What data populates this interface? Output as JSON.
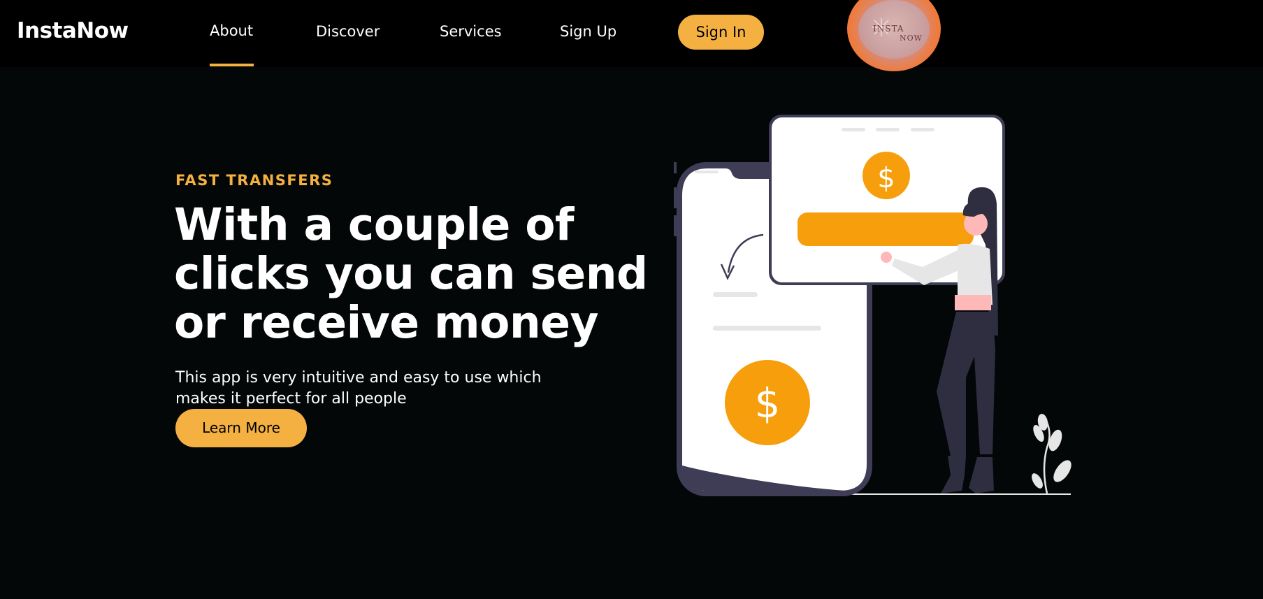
{
  "header": {
    "brand": "InstaNow",
    "nav": [
      {
        "label": "About",
        "active": true
      },
      {
        "label": "Discover"
      },
      {
        "label": "Services"
      },
      {
        "label": "Sign Up"
      }
    ],
    "signin_label": "Sign In",
    "logo_text_top": "INSTA",
    "logo_text_bottom": "NOW"
  },
  "hero": {
    "eyebrow": "FAST TRANSFERS",
    "headline_lines": [
      "With a couple of",
      "clicks you can send",
      "or receive money"
    ],
    "subtext_lines": [
      "This app is very intuitive and easy to use which",
      "makes it perfect for all people"
    ],
    "cta_label": "Learn More"
  },
  "illustration": {
    "currency_symbol": "$",
    "icons": [
      "phone-icon",
      "payment-card-icon",
      "dollar-coin-icon",
      "woman-figure",
      "plant-icon",
      "curved-arrow-icon"
    ]
  },
  "colors": {
    "accent": "#f5b042",
    "coin": "#f79e0c",
    "background": "#030708",
    "navbar": "#000000",
    "dark_figure": "#2f2e41"
  }
}
